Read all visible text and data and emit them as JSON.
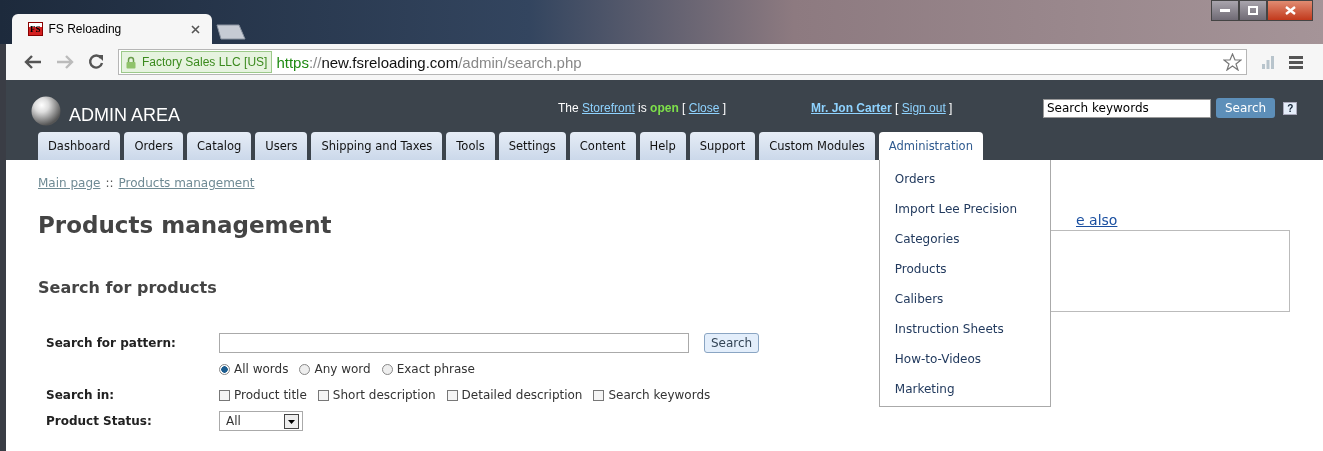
{
  "browser": {
    "tabs": [
      {
        "title": "FS Reloading",
        "favicon": "FS",
        "selected": true
      }
    ],
    "security_badge": "Factory Sales LLC [US]",
    "url": {
      "scheme": "https",
      "separator": "://",
      "host": "new.fsreloading.com",
      "path": "/admin/search.php"
    }
  },
  "header": {
    "title": "ADMIN AREA",
    "store_status": {
      "lead": "The",
      "link": "Storefront",
      "verb": "is",
      "state": "open",
      "open_bracket": "[",
      "action": "Close",
      "close_bracket": "]"
    },
    "user": {
      "name": "Mr. Jon Carter",
      "open_bracket": "[",
      "action": "Sign out",
      "close_bracket": "]"
    },
    "search": {
      "value": "Search keywords",
      "button": "Search",
      "help": "?"
    }
  },
  "nav_tabs": [
    {
      "label": "Dashboard",
      "selected": false
    },
    {
      "label": "Orders",
      "selected": false
    },
    {
      "label": "Catalog",
      "selected": false
    },
    {
      "label": "Users",
      "selected": false
    },
    {
      "label": "Shipping and Taxes",
      "selected": false
    },
    {
      "label": "Tools",
      "selected": false
    },
    {
      "label": "Settings",
      "selected": false
    },
    {
      "label": "Content",
      "selected": false
    },
    {
      "label": "Help",
      "selected": false
    },
    {
      "label": "Support",
      "selected": false
    },
    {
      "label": "Custom Modules",
      "selected": false
    },
    {
      "label": "Administration",
      "selected": true
    }
  ],
  "dropdown_menu": [
    "Orders",
    "Import Lee Precision",
    "Categories",
    "Products",
    "Calibers",
    "Instruction Sheets",
    "How-to-Videos",
    "Marketing"
  ],
  "breadcrumb": {
    "items": [
      "Main page",
      "Products management"
    ],
    "separator": "::"
  },
  "page_title": "Products management",
  "side_panel": {
    "heading": "e also"
  },
  "search_form": {
    "title": "Search for products",
    "pattern": {
      "label": "Search for pattern:",
      "button": "Search"
    },
    "match_modes": [
      {
        "label": "All words",
        "selected": true
      },
      {
        "label": "Any word",
        "selected": false
      },
      {
        "label": "Exact phrase",
        "selected": false
      }
    ],
    "search_in": {
      "label": "Search in:",
      "options": [
        {
          "label": "Product title",
          "checked": false
        },
        {
          "label": "Short description",
          "checked": false
        },
        {
          "label": "Detailed description",
          "checked": false
        },
        {
          "label": "Search keywords",
          "checked": false
        }
      ]
    },
    "status": {
      "label": "Product Status:",
      "value": "All"
    }
  }
}
